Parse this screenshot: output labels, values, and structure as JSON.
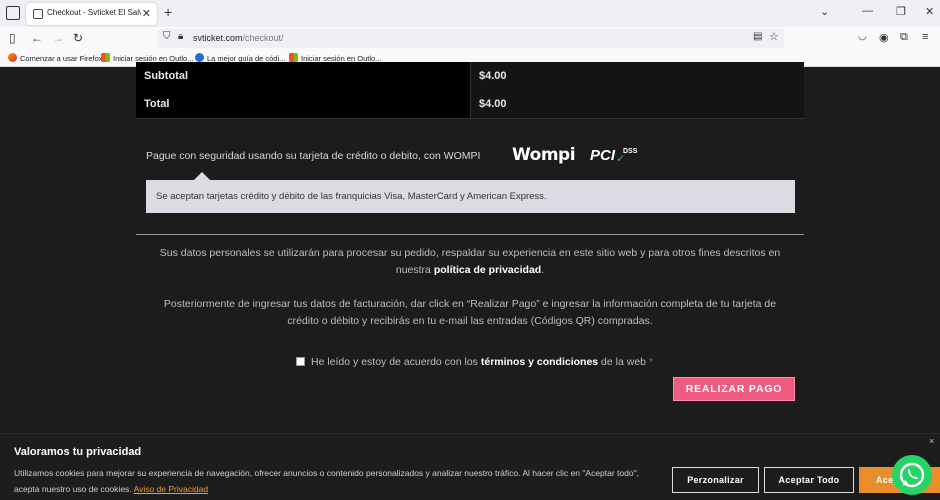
{
  "browser": {
    "tab_title": "Checkout - Svticket El Salvador",
    "url_host": "svticket.com",
    "url_path": "/checkout/",
    "bookmarks": [
      "Comenzar a usar Firefox",
      "Iniciar sesión en Outlo...",
      "La mejor guía de códi...",
      "Iniciar sesión en Outlo..."
    ]
  },
  "order": {
    "rows": [
      {
        "label": "Subtotal",
        "value": "$4.00"
      },
      {
        "label": "Total",
        "value": "$4.00"
      }
    ]
  },
  "payment": {
    "method_text": "Pague con seguridad usando su tarjeta de crédito o debito, con WOMPI",
    "logo_wompi": "Wompi",
    "logo_pci": "PCI",
    "logo_dss": "DSS",
    "notice": "Se aceptan tarjetas crédito y débito de las franquicias Visa, MasterCard y American Express."
  },
  "privacy": {
    "text_before": "Sus datos personales se utilizarán para procesar su pedido, respaldar su experiencia en este sitio web y para otros fines descritos en nuestra ",
    "link": "política de privacidad",
    "text_after": "."
  },
  "instructions": "Posteriormente de ingresar tus datos de facturación, dar click en “Realizar Pago” e ingresar la información completa de tu tarjeta de crédito o débito y recibirás en tu e-mail las entradas (Códigos QR) compradas.",
  "terms": {
    "before": "He leído y estoy de acuerdo con los ",
    "link": "términos y condiciones",
    "after": " de la web ",
    "required": "*"
  },
  "pay_button": "REALIZAR PAGO",
  "cookie": {
    "title": "Valoramos tu privacidad",
    "text": "Utilizamos cookies para mejorar su experiencia de navegación, ofrecer anuncios o contenido personalizados y analizar nuestro tráfico. Al hacer clic en \"Aceptar todo\", acepta nuestro uso de cookies. ",
    "link": "Aviso de Privacidad",
    "btn_customize": "Perzonalizar",
    "btn_accept_all": "Aceptar Todo",
    "btn_accept": "Acep",
    "close": "×"
  }
}
